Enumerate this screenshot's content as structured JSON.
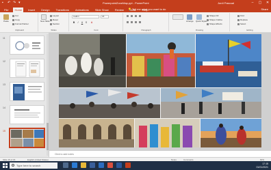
{
  "window": {
    "title": "PowerpointZoneMap.ppt - PowerPoint",
    "user": "Jordi Pascual",
    "controls": [
      "–",
      "▢",
      "✕"
    ],
    "qat_icons": [
      "save-icon",
      "undo-icon",
      "redo-icon",
      "customize-icon"
    ]
  },
  "ribbon_tabs": {
    "items": [
      "File",
      "Home",
      "Insert",
      "Design",
      "Transitions",
      "Animations",
      "Slide Show",
      "Review",
      "View",
      "Help"
    ],
    "active": "Home",
    "tell_me": "Tell me what you want to do",
    "share": "Share"
  },
  "ribbon": {
    "clipboard": {
      "paste": "Paste",
      "cut": "Cut",
      "copy": "Copy",
      "format_painter": "Format Painter",
      "label": "Clipboard"
    },
    "slides": {
      "new_slide": "New Slide",
      "layout": "Layout",
      "reset": "Reset",
      "section": "Section",
      "label": "Slides"
    },
    "font": {
      "name": "Calibri",
      "size": "18",
      "label": "Font",
      "buttons": [
        "B",
        "I",
        "U",
        "S",
        "A"
      ]
    },
    "paragraph": {
      "label": "Paragraph"
    },
    "drawing": {
      "arrange": "Arrange",
      "quick_styles": "Quick Styles",
      "shape_fill": "Shape Fill",
      "shape_outline": "Shape Outline",
      "shape_effects": "Shape Effects",
      "label": "Drawing"
    },
    "editing": {
      "find": "Find",
      "replace": "Replace",
      "select": "Select",
      "label": "Editing"
    }
  },
  "thumbnails": [
    {
      "num": "11",
      "selected": false
    },
    {
      "num": "12",
      "selected": false
    },
    {
      "num": "13",
      "selected": false
    },
    {
      "num": "14",
      "selected": false
    },
    {
      "num": "15",
      "selected": true
    }
  ],
  "notes": {
    "placeholder": "Click to add notes"
  },
  "status": {
    "slide": "Slide 15 of 15",
    "language": "English (United States)",
    "notes": "Notes",
    "comments": "Comments",
    "zoom": "60%"
  },
  "taskbar": {
    "search_placeholder": "Type here to search",
    "time": "17:15",
    "date": "01/01/2021",
    "app_icons": [
      "task-view-icon",
      "edge-icon",
      "file-explorer-icon",
      "store-icon",
      "mail-icon",
      "chrome-icon",
      "word-icon",
      "powerpoint-icon"
    ]
  },
  "colors": {
    "brand": "#c43e1c",
    "ribbon_bg": "#f3f2f1",
    "taskbar": "#1f2f45"
  }
}
